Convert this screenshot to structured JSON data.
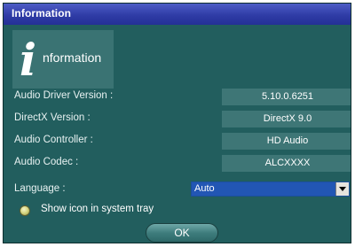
{
  "window": {
    "title": "Information"
  },
  "logo": {
    "initial": "i",
    "word": "nformation"
  },
  "info": [
    {
      "label": "Audio Driver Version :",
      "value": "5.10.0.6251"
    },
    {
      "label": "DirectX Version :",
      "value": "DirectX 9.0"
    },
    {
      "label": "Audio Controller :",
      "value": "HD Audio"
    },
    {
      "label": "Audio Codec :",
      "value": "ALCXXXX"
    }
  ],
  "language": {
    "label": "Language :",
    "selected": "Auto"
  },
  "tray": {
    "label": "Show icon in system tray"
  },
  "buttons": {
    "ok": "OK"
  },
  "colors": {
    "panel": "#225e5e",
    "titlebar": "#2f3ca6",
    "value_box": "#3e7676",
    "selection": "#2256b4"
  }
}
